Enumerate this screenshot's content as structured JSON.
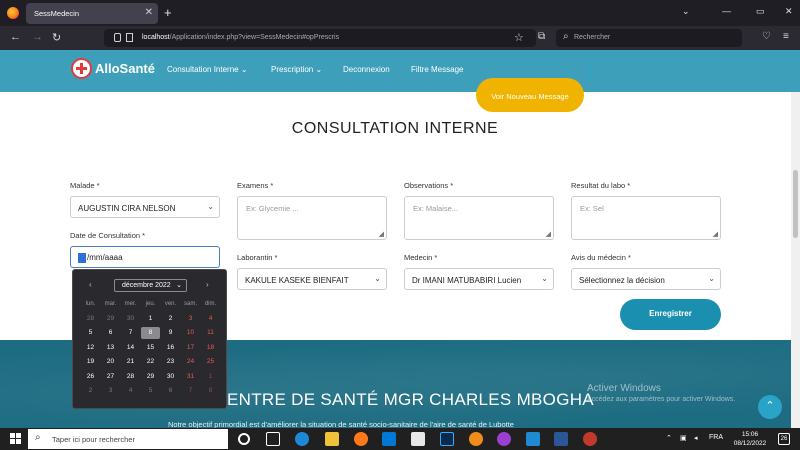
{
  "browser": {
    "tab_title": "SessMedecin",
    "url_host": "localhost",
    "url_path": "/Application/index.php?view=SessMedecin#opPrescris",
    "search_placeholder": "Rechercher"
  },
  "header": {
    "logo": "AlloSanté",
    "menu": [
      "Consultation Interne ⌄",
      "Prescription ⌄",
      "Deconnexion",
      "Filtre Message"
    ],
    "new_message_button": "Voir Nouveau Message",
    "message_count": "1"
  },
  "page": {
    "title": "CONSULTATION INTERNE"
  },
  "form": {
    "malade": {
      "label": "Malade *",
      "value": "AUGUSTIN CIRA NELSON"
    },
    "examens": {
      "label": "Examens *",
      "placeholder": "Ex: Glycemie ..."
    },
    "observations": {
      "label": "Observations *",
      "placeholder": "Ex: Malaise..."
    },
    "resultat": {
      "label": "Resultat du labo *",
      "placeholder": "Ex: Sel"
    },
    "date": {
      "label": "Date de Consultation *",
      "value": "jj/mm/aaaa",
      "value_rest": "/mm/aaaa"
    },
    "laborantin": {
      "label": "Laborantin *",
      "value": "KAKULE KASEKE BIENFAIT"
    },
    "medecin": {
      "label": "Medecin *",
      "value": "Dr IMANI MATUBABIRI Lucien"
    },
    "avis": {
      "label": "Avis du médecin *",
      "value": "Sélectionnez la décision"
    },
    "save_button": "Enregistrer"
  },
  "calendar": {
    "month": "décembre 2022",
    "weekdays": [
      "lun.",
      "mar.",
      "mer.",
      "jeu.",
      "ven.",
      "sam.",
      "dim."
    ],
    "weeks": [
      [
        "28",
        "29",
        "30",
        "1",
        "2",
        "3",
        "4"
      ],
      [
        "5",
        "6",
        "7",
        "8",
        "9",
        "10",
        "11"
      ],
      [
        "12",
        "13",
        "14",
        "15",
        "16",
        "17",
        "18"
      ],
      [
        "19",
        "20",
        "21",
        "22",
        "23",
        "24",
        "25"
      ],
      [
        "26",
        "27",
        "28",
        "29",
        "30",
        "31",
        "1"
      ],
      [
        "2",
        "3",
        "4",
        "5",
        "6",
        "7",
        "8"
      ]
    ],
    "selected_day": "8"
  },
  "footer": {
    "center_name": "ENTRE DE SANTÉ MGR CHARLES MBOGHA",
    "description": "Notre objectif primordial est d'améliorer la situation de santé socio-sanitaire de l'aire de santé de Lubotte",
    "activate_title": "Activer Windows",
    "activate_sub": "Accédez aux paramètres pour activer Windows."
  },
  "taskbar": {
    "search_placeholder": "Taper ici pour rechercher",
    "language": "FRA",
    "time": "15:06",
    "date": "08/12/2022",
    "notifications": "26"
  },
  "colors": {
    "header_bg": "#3d9fb9",
    "accent": "#1b8fb0",
    "message_bubble": "#f0b400",
    "footer_bg": "#1d6c82"
  }
}
